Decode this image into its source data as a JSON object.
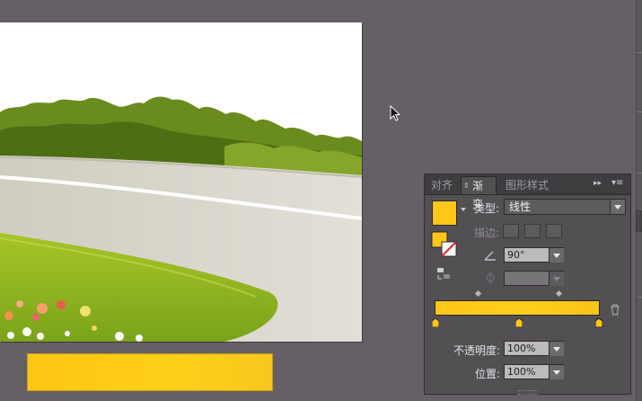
{
  "colors": {
    "canvas_bg": "#646065",
    "gradient_start": "#ffc713",
    "gradient_end": "#f9c71c"
  },
  "panel": {
    "tabs": [
      {
        "label": "对齐",
        "active": false
      },
      {
        "label": "渐变",
        "active": true
      },
      {
        "label": "图形样式",
        "active": false
      }
    ],
    "type_label": "类型:",
    "type_value": "线性",
    "stroke_label": "描边:",
    "angle_value": "90°",
    "aspect_value": "",
    "opacity_label": "不透明度:",
    "opacity_value": "100%",
    "position_label": "位置:",
    "position_value": "100%",
    "icons": {
      "angle": "angle-icon",
      "aspect": "aspect-ratio-icon",
      "reverse": "reverse-gradient-icon",
      "delete": "trash-icon",
      "collapse": "collapse-panel-icon",
      "menu": "panel-menu-icon"
    }
  }
}
